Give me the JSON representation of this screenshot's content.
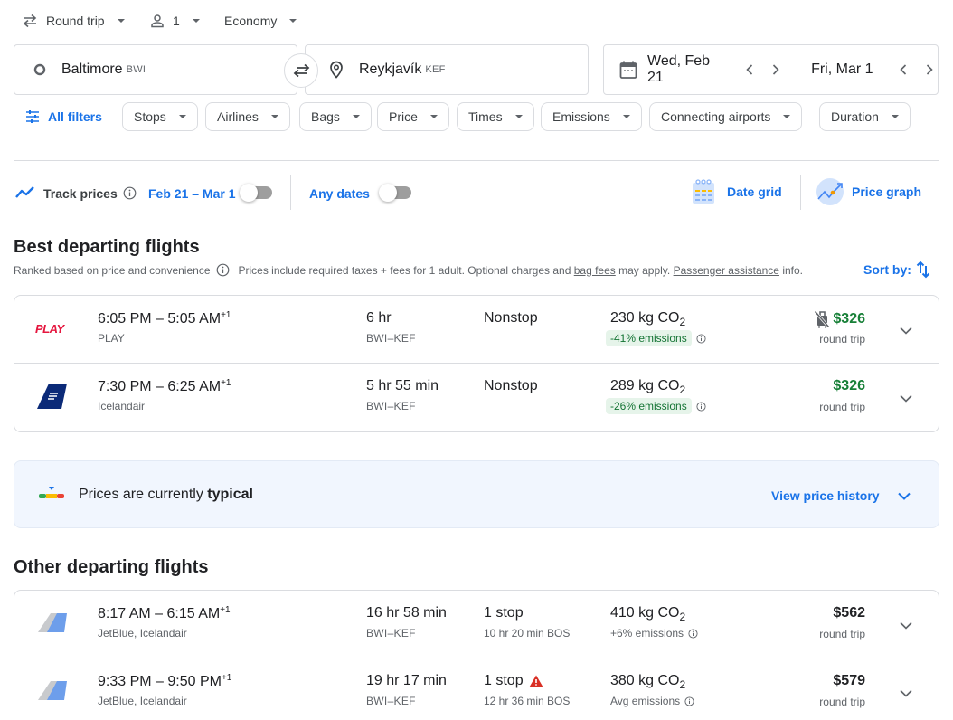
{
  "trip_options": {
    "trip_type": "Round trip",
    "passengers": "1",
    "cabin_class": "Economy"
  },
  "search": {
    "origin": {
      "city": "Baltimore",
      "code": "BWI"
    },
    "destination": {
      "city": "Reykjavík",
      "code": "KEF"
    },
    "depart_date": "Wed, Feb 21",
    "return_date": "Fri, Mar 1"
  },
  "filters": {
    "all_filters_label": "All filters",
    "chips": [
      "Stops",
      "Airlines",
      "Bags",
      "Price",
      "Times",
      "Emissions",
      "Connecting airports",
      "Duration"
    ]
  },
  "tracking": {
    "track_label": "Track prices",
    "date_range": "Feb 21 – Mar 1",
    "date_range_toggle_on": false,
    "any_dates_label": "Any dates",
    "any_dates_toggle_on": false,
    "date_grid_label": "Date grid",
    "price_graph_label": "Price graph"
  },
  "best_section": {
    "title": "Best departing flights",
    "ranked_note": "Ranked based on price and convenience",
    "price_note_prefix": "Prices include required taxes + fees for 1 adult. Optional charges and ",
    "bag_fees_link": "bag fees",
    "price_note_middle": " may apply. ",
    "assistance_link": "Passenger assistance",
    "price_note_suffix": " info.",
    "sort_label": "Sort by:"
  },
  "best_flights": [
    {
      "airline_logo": "play-logo",
      "times": "6:05 PM – 5:05 AM",
      "day_offset": "+1",
      "airline": "PLAY",
      "duration": "6 hr",
      "route": "BWI–KEF",
      "stops": "Nonstop",
      "layover": "",
      "co2_value": "230 kg CO",
      "co2_sub": "2",
      "emissions": "-41% emissions",
      "emissions_style": "badge",
      "price": "$326",
      "price_color": "#188038",
      "price_type": "round trip",
      "no_carry_on": true
    },
    {
      "airline_logo": "icelandair-logo",
      "times": "7:30 PM – 6:25 AM",
      "day_offset": "+1",
      "airline": "Icelandair",
      "duration": "5 hr 55 min",
      "route": "BWI–KEF",
      "stops": "Nonstop",
      "layover": "",
      "co2_value": "289 kg CO",
      "co2_sub": "2",
      "emissions": "-26% emissions",
      "emissions_style": "badge",
      "price": "$326",
      "price_color": "#188038",
      "price_type": "round trip",
      "no_carry_on": false
    }
  ],
  "price_insight": {
    "text_prefix": "Prices are currently ",
    "level": "typical",
    "link": "View price history"
  },
  "other_section": {
    "title": "Other departing flights"
  },
  "other_flights": [
    {
      "airline_logo": "multi-airline-logo",
      "times": "8:17 AM – 6:15 AM",
      "day_offset": "+1",
      "airline": "JetBlue, Icelandair",
      "duration": "16 hr 58 min",
      "route": "BWI–KEF",
      "stops": "1 stop",
      "layover": "10 hr 20 min BOS",
      "co2_value": "410 kg CO",
      "co2_sub": "2",
      "emissions": "+6% emissions",
      "emissions_style": "plain",
      "price": "$562",
      "price_color": "#202124",
      "price_type": "round trip",
      "warning": false
    },
    {
      "airline_logo": "multi-airline-logo",
      "times": "9:33 PM – 9:50 PM",
      "day_offset": "+1",
      "airline": "JetBlue, Icelandair",
      "duration": "19 hr 17 min",
      "route": "BWI–KEF",
      "stops": "1 stop",
      "layover": "12 hr 36 min BOS",
      "co2_value": "380 kg CO",
      "co2_sub": "2",
      "emissions": "Avg emissions",
      "emissions_style": "plain",
      "price": "$579",
      "price_color": "#202124",
      "price_type": "round trip",
      "warning": true
    }
  ],
  "colors": {
    "accent_blue": "#1a73e8",
    "price_green": "#188038",
    "badge_green_bg": "#e6f4ea",
    "badge_green_text": "#137333",
    "warning_red": "#d93025",
    "insight_bg": "#f1f6fe"
  }
}
